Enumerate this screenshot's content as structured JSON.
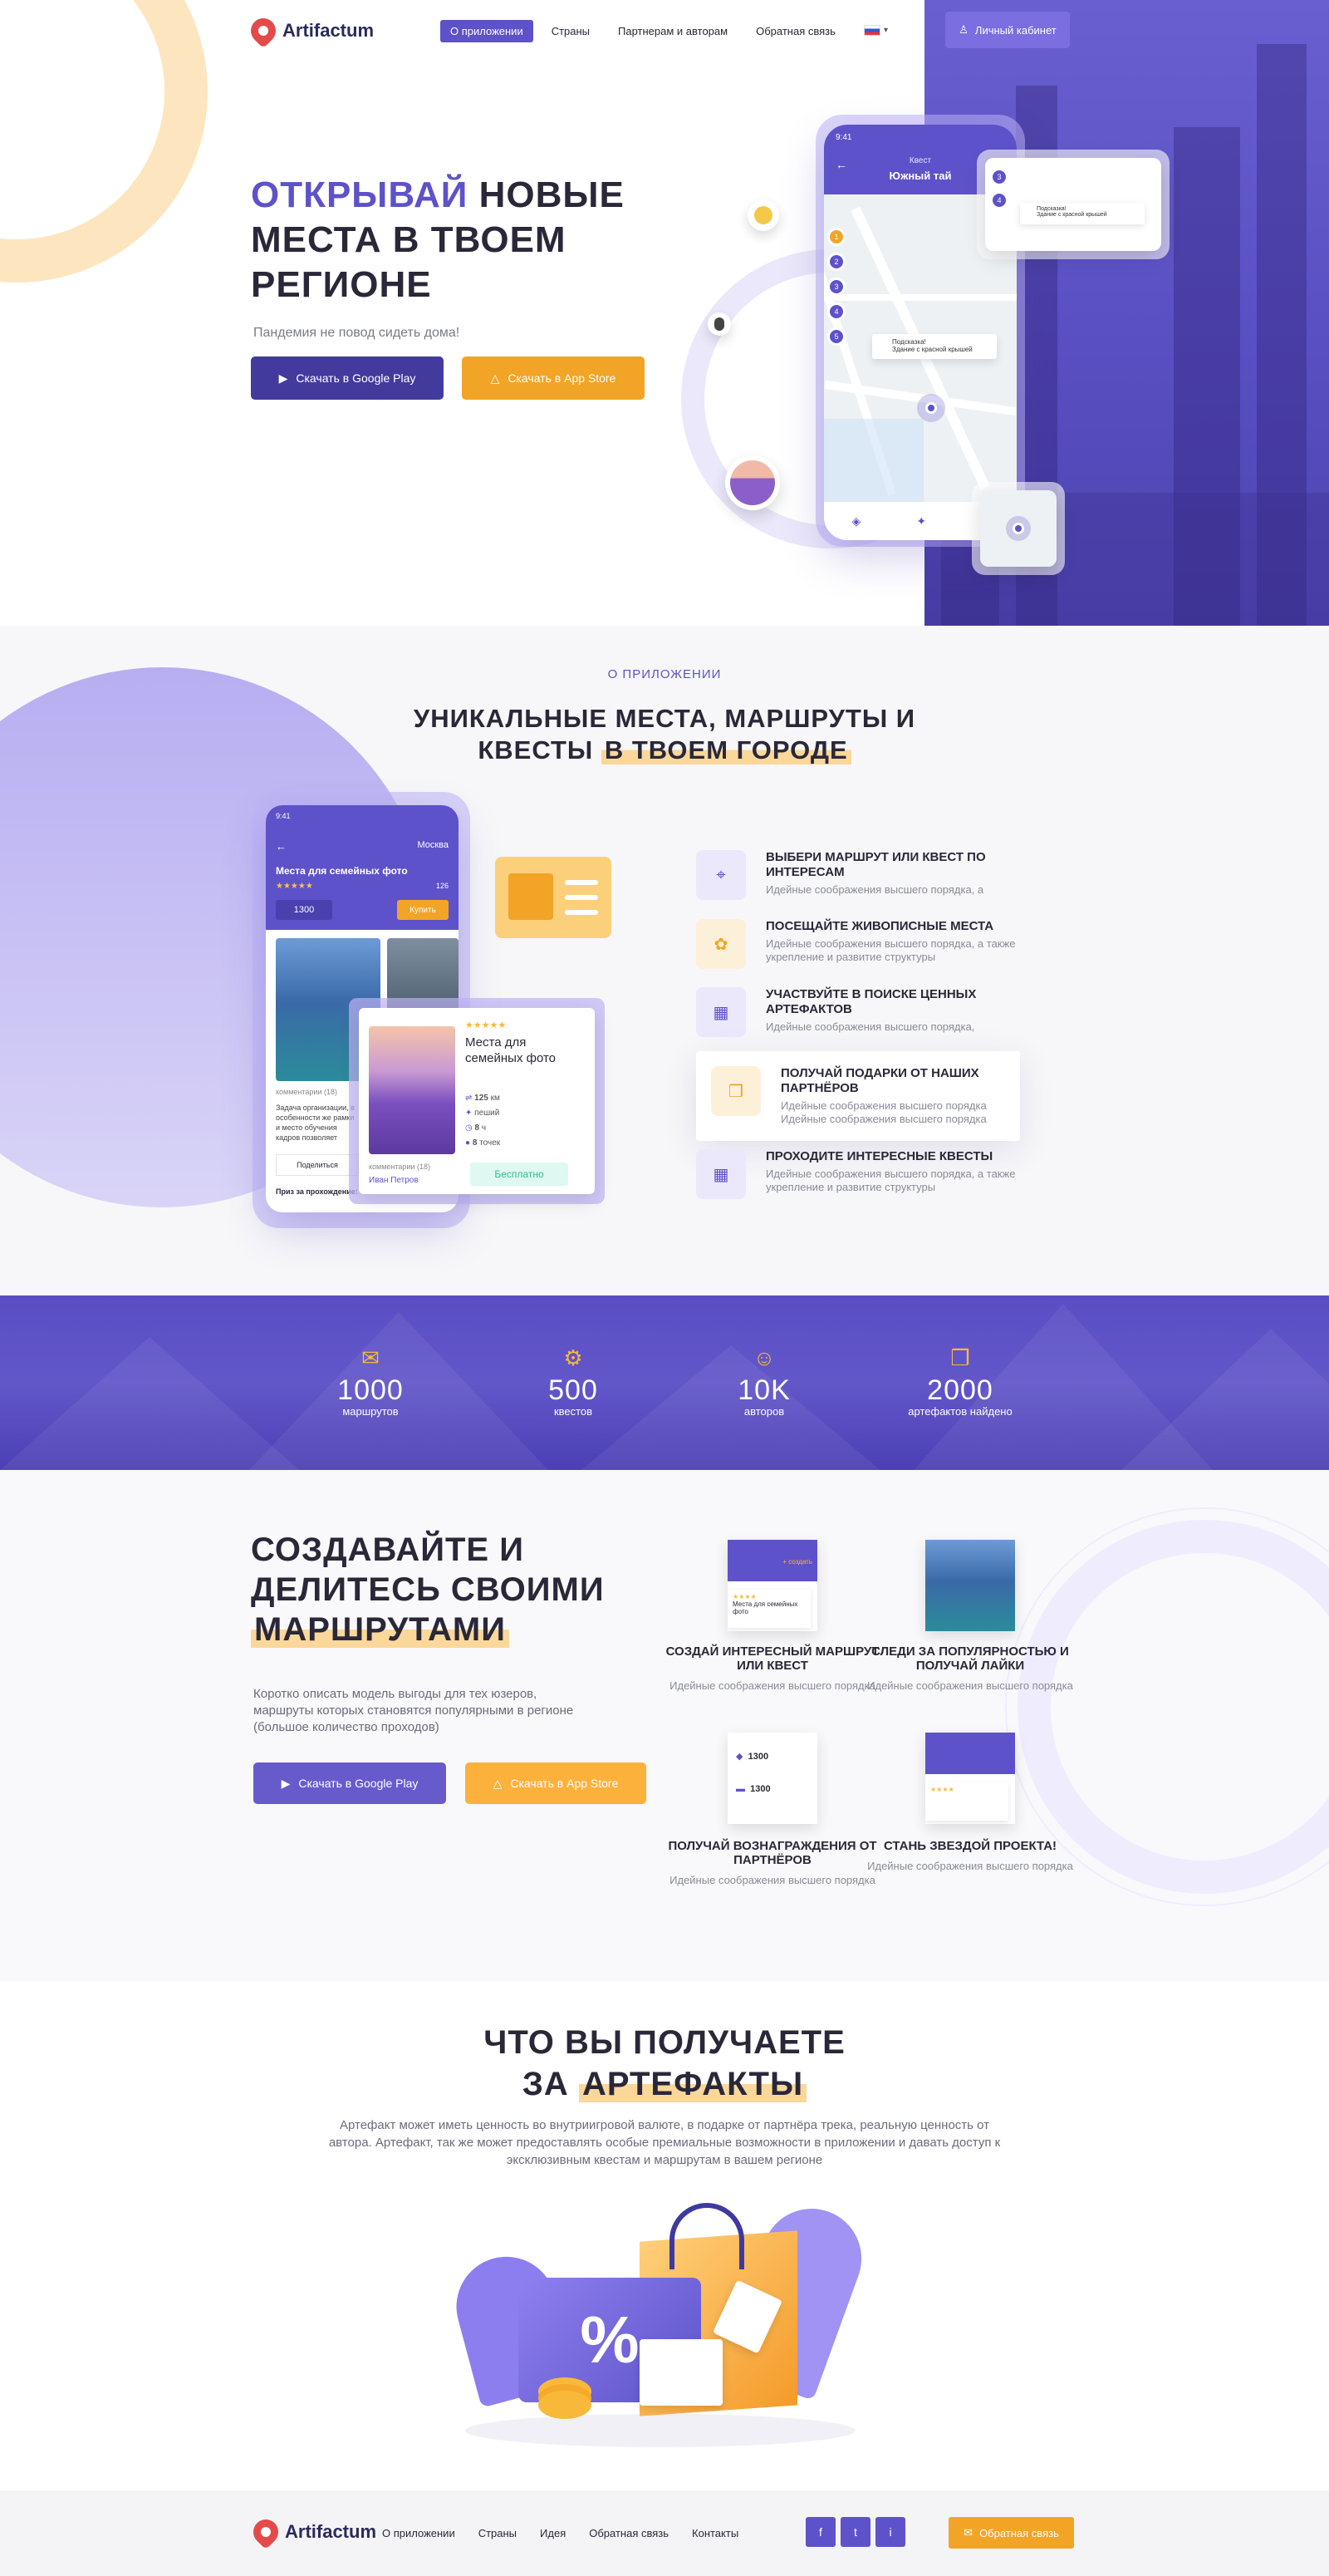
{
  "brand": {
    "name": "Artifactum"
  },
  "header": {
    "nav": [
      "О приложении",
      "Страны",
      "Партнерам и авторам",
      "Обратная связь"
    ],
    "cabinet_label": "Личный кабинет"
  },
  "hero": {
    "title_accent": "ОТКРЫВАЙ",
    "title_rest": "НОВЫЕ МЕСТА В ТВОЕМ РЕГИОНЕ",
    "subtitle": "Пандемия не повод сидеть дома!",
    "google_play": "Скачать в Google Play",
    "app_store": "Скачать в App Store",
    "phone": {
      "time": "9:41",
      "kicker": "Квест",
      "title": "Южный тай",
      "popup1_title": "Подсказка!",
      "popup1_text": "Здание с красной крышей",
      "popup2_title": "Подсказка!",
      "popup2_text": "Здание с красной крышей"
    }
  },
  "about": {
    "kicker": "О ПРИЛОЖЕНИИ",
    "title_line1": "УНИКАЛЬНЫЕ МЕСТА, МАРШРУТЫ И",
    "title_line2_prefix": "КВЕСТЫ",
    "title_line2_hl": "В ТВОЕМ ГОРОДЕ",
    "phone": {
      "time": "9:41",
      "city": "Москва",
      "route_title": "Места для семейных фото",
      "rating_count": "126",
      "price": "1300",
      "buy": "Купить",
      "comments": "комментарии (18)",
      "desc": "Задача организации, в особенности же рамки и место обучения кадров позволяет оценить значение форм развития.",
      "share": "Поделиться",
      "prize": "Приз за прохождение:"
    },
    "card": {
      "title": "Места для семейных фото",
      "distance": "125",
      "distance_unit": "км",
      "mode": "пеший",
      "time": "8",
      "time_unit": "ч",
      "points": "8",
      "points_unit": "точек",
      "comments": "комментарии (18)",
      "author": "Иван Петров",
      "free": "Бесплатно"
    },
    "features": [
      {
        "title": "ВЫБЕРИ МАРШРУТ ИЛИ КВЕСТ ПО ИНТЕРЕСАМ",
        "desc": "Идейные соображения высшего порядка, а"
      },
      {
        "title": "ПОСЕЩАЙТЕ ЖИВОПИСНЫЕ МЕСТА",
        "desc": "Идейные соображения высшего порядка, а также укрепление и развитие структуры"
      },
      {
        "title": "УЧАСТВУЙТЕ В ПОИСКЕ ЦЕННЫХ АРТЕФАКТОВ",
        "desc": "Идейные соображения высшего порядка,"
      },
      {
        "title": "ПОЛУЧАЙ ПОДАРКИ ОТ НАШИХ ПАРТНЁРОВ",
        "desc": "Идейные соображения высшего порядка Идейные соображения высшего порядка"
      },
      {
        "title": "ПРОХОДИТЕ ИНТЕРЕСНЫЕ КВЕСТЫ",
        "desc": "Идейные соображения высшего порядка, а также укрепление и развитие структуры"
      }
    ]
  },
  "stats": [
    {
      "num": "1000",
      "label": "маршрутов"
    },
    {
      "num": "500",
      "label": "квестов"
    },
    {
      "num": "10K",
      "label": "авторов"
    },
    {
      "num": "2000",
      "label": "артефактов найдено"
    }
  ],
  "create": {
    "title_line1": "СОЗДАВАЙТЕ И",
    "title_line2": "ДЕЛИТЕСЬ СВОИМИ",
    "title_hl": "МАРШРУТАМИ",
    "desc": "Коротко описать модель выгоды для тех юзеров, маршруты которых становятся популярными в регионе (большое количество проходов)",
    "google_play": "Скачать в Google Play",
    "app_store": "Скачать в App Store",
    "mini_create": "+ создать",
    "mini_route": "Места для семейных фото",
    "mini_price1": "1300",
    "mini_price2": "1300",
    "cards": [
      {
        "title": "СОЗДАЙ ИНТЕРЕСНЫЙ МАРШРУТ ИЛИ КВЕСТ",
        "desc": "Идейные соображения высшего порядка"
      },
      {
        "title": "СЛЕДИ ЗА ПОПУЛЯРНОСТЬЮ И ПОЛУЧАЙ ЛАЙКИ",
        "desc": "Идейные соображения высшего порядка"
      },
      {
        "title": "ПОЛУЧАЙ ВОЗНАГРАЖДЕНИЯ ОТ ПАРТНЁРОВ",
        "desc": "Идейные соображения высшего порядка"
      },
      {
        "title": "СТАНЬ ЗВЕЗДОЙ ПРОЕКТА!",
        "desc": "Идейные соображения высшего порядка"
      }
    ]
  },
  "artifacts": {
    "title_line1": "ЧТО ВЫ ПОЛУЧАЕТЕ",
    "title_prefix": "ЗА",
    "title_hl": "АРТЕФАКТЫ",
    "desc": "Артефакт может иметь ценность во внутриигровой валюте, в подарке от партнёра трека, реальную ценность от автора. Артефакт, так же может предоставлять особые премиальные возможности в приложении и давать доступ к эксклюзивным квестам и маршрутам в вашем регионе"
  },
  "footer": {
    "nav": [
      "О приложении",
      "Страны",
      "Идея",
      "Обратная связь",
      "Контакты"
    ],
    "feedback": "Обратная связь",
    "social": [
      "f",
      "t",
      "i"
    ]
  },
  "colors": {
    "primary": "#5d52c9",
    "accent": "#f2a426",
    "highlight": "#fcd79a"
  }
}
